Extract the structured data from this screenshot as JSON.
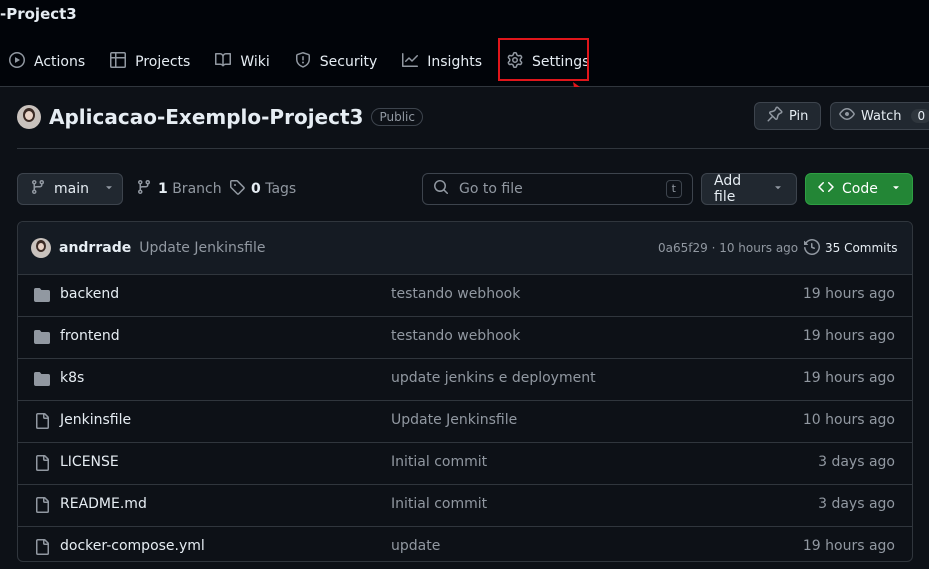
{
  "header": {
    "repo_crumb": "-Project3",
    "nav": [
      {
        "label": "Actions",
        "icon": "play-icon"
      },
      {
        "label": "Projects",
        "icon": "table-icon"
      },
      {
        "label": "Wiki",
        "icon": "book-icon"
      },
      {
        "label": "Security",
        "icon": "shield-icon"
      },
      {
        "label": "Insights",
        "icon": "graph-icon"
      },
      {
        "label": "Settings",
        "icon": "gear-icon"
      }
    ],
    "annotation_color": "#e0161b"
  },
  "repo": {
    "name": "Aplicacao-Exemplo-Project3",
    "visibility": "Public",
    "pin_label": "Pin",
    "watch_label": "Watch",
    "watch_count": "0"
  },
  "toolbar": {
    "branch": "main",
    "branch_count": "1",
    "branch_label": "Branch",
    "tag_count": "0",
    "tag_label": "Tags",
    "search_placeholder": "Go to file",
    "search_shortcut": "t",
    "add_file_label": "Add file",
    "code_label": "Code",
    "code_color": "#238636"
  },
  "latest_commit": {
    "author": "andrrade",
    "message": "Update Jenkinsfile",
    "meta": "0a65f29 · 10 hours ago",
    "commits_label": "35 Commits"
  },
  "files": [
    {
      "name": "backend",
      "type": "folder",
      "message": "testando webhook",
      "time": "19 hours ago"
    },
    {
      "name": "frontend",
      "type": "folder",
      "message": "testando webhook",
      "time": "19 hours ago"
    },
    {
      "name": "k8s",
      "type": "folder",
      "message": "update jenkins e deployment",
      "time": "19 hours ago"
    },
    {
      "name": "Jenkinsfile",
      "type": "file",
      "message": "Update Jenkinsfile",
      "time": "10 hours ago"
    },
    {
      "name": "LICENSE",
      "type": "file",
      "message": "Initial commit",
      "time": "3 days ago"
    },
    {
      "name": "README.md",
      "type": "file",
      "message": "Initial commit",
      "time": "3 days ago"
    },
    {
      "name": "docker-compose.yml",
      "type": "file",
      "message": "update",
      "time": "19 hours ago"
    }
  ]
}
